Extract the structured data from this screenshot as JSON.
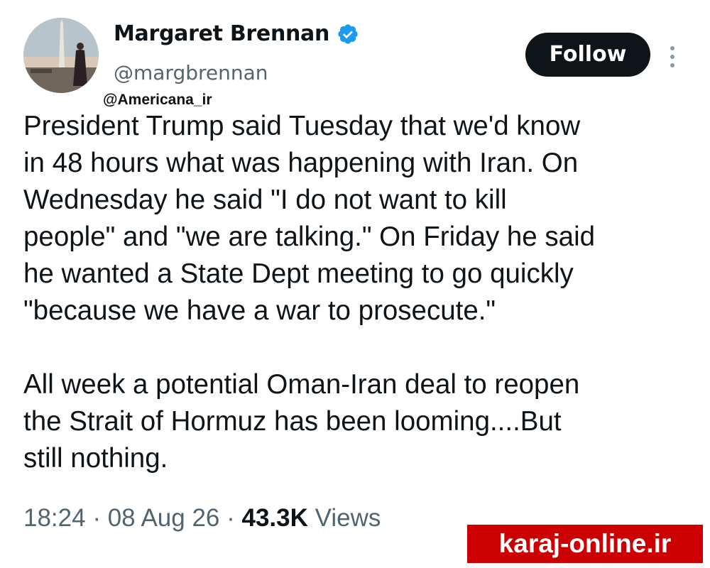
{
  "author": {
    "display_name": "Margaret Brennan",
    "handle": "@margbrennan",
    "verified": true,
    "verified_badge_color": "#1d9bf0"
  },
  "overlay_watermark": "@Americana_ir",
  "follow_button_label": "Follow",
  "tweet": {
    "paragraphs": [
      "President Trump said Tuesday that we'd know\nin 48 hours what was happening with Iran. On\nWednesday he said \"I do not want to kill\npeople\" and \"we are talking.\" On Friday he said\nhe wanted a State Dept meeting to go quickly\n\"because we have a war to prosecute.\"",
      "All week a potential Oman-Iran deal to reopen\nthe Strait of Hormuz has been looming....But\nstill nothing."
    ]
  },
  "meta": {
    "time": "18:24",
    "date": "08 Aug 26",
    "views_count": "43.3K",
    "views_label": "Views"
  },
  "site_badge": {
    "text": "karaj-online.ir",
    "background": "#cc0000"
  },
  "icons": {
    "verified": "verified-check-icon",
    "more": "more-vertical-icon"
  }
}
